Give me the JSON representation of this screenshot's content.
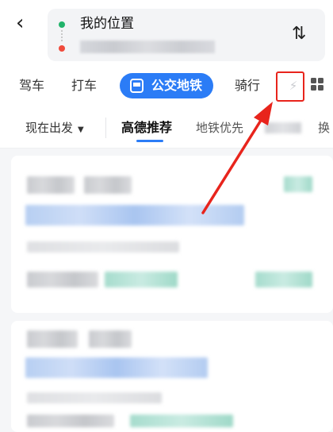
{
  "nav": {
    "back_glyph": "‹"
  },
  "location": {
    "from_label": "我的位置",
    "swap_glyph": "⇅"
  },
  "modes": {
    "drive": "驾车",
    "taxi": "打车",
    "transit": "公交地铁",
    "ride": "骑行",
    "more_glyph": "⚡"
  },
  "filters": {
    "depart": "现在出发",
    "depart_caret": "▼",
    "recommended": "高德推荐",
    "subway_first": "地铁优先",
    "cut_tab": "换"
  },
  "colors": {
    "accent": "#2b7cf6",
    "highlight": "#e8241c",
    "origin_dot": "#21b36a",
    "destination_dot": "#f04b3c"
  },
  "icons": [
    "back-icon",
    "swap-icon",
    "bus-icon",
    "more-modes-icon",
    "grid-icon",
    "dropdown-caret-icon"
  ]
}
